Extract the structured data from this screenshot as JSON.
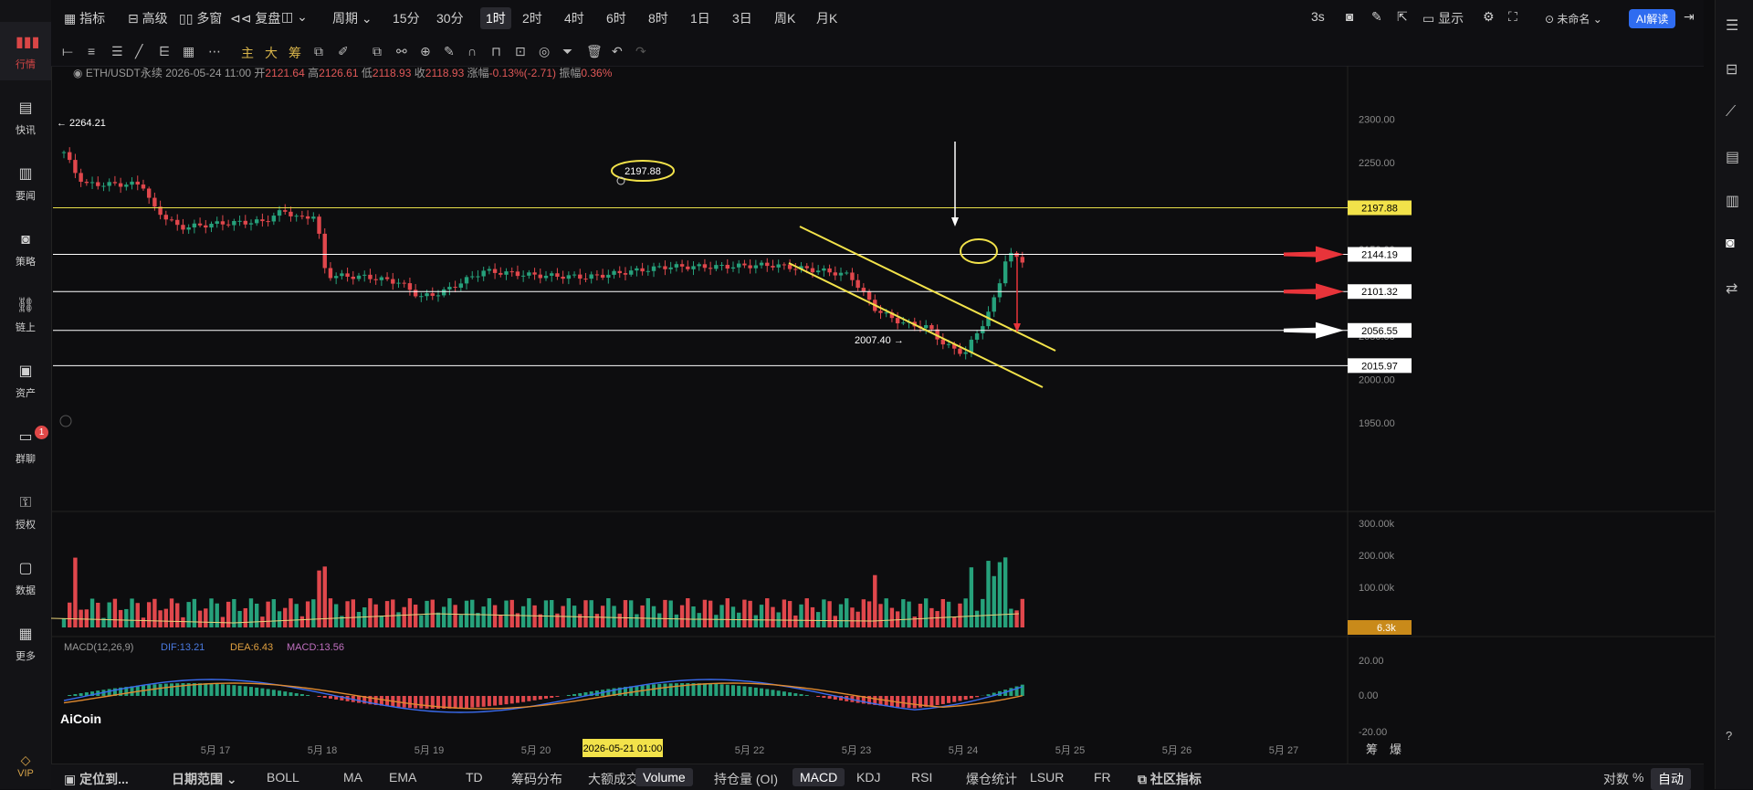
{
  "sidebar": {
    "items": [
      {
        "label": "行情",
        "icon": "bar-chart-icon",
        "active": true
      },
      {
        "label": "快讯",
        "icon": "news-flash-icon"
      },
      {
        "label": "要闻",
        "icon": "document-icon"
      },
      {
        "label": "策略",
        "icon": "robot-icon"
      },
      {
        "label": "链上",
        "icon": "chain-icon"
      },
      {
        "label": "资产",
        "icon": "wallet-icon"
      },
      {
        "label": "群聊",
        "icon": "chat-icon",
        "badge": "1"
      },
      {
        "label": "授权",
        "icon": "key-icon"
      },
      {
        "label": "数据",
        "icon": "monitor-icon"
      },
      {
        "label": "更多",
        "icon": "grid-icon"
      }
    ],
    "vip": "VIP"
  },
  "topbar": {
    "indicator": "指标",
    "advanced": "高级",
    "multi": "多窗",
    "replay": "复盘",
    "period": "周期",
    "timeframes": [
      "15分",
      "30分",
      "1时",
      "2时",
      "4时",
      "6时",
      "8时",
      "1日",
      "3日",
      "周K",
      "月K"
    ],
    "active_timeframe": "1时",
    "refresh": "3s",
    "display": "显示",
    "layout_name": "未命名",
    "ai": "AI解读"
  },
  "info": {
    "symbol": "ETH/USDT永续",
    "datetime": "2026-05-24 11:00",
    "open_label": "开",
    "open": "2121.64",
    "high_label": "高",
    "high": "2126.61",
    "low_label": "低",
    "low": "2118.93",
    "close_label": "收",
    "close": "2118.93",
    "change_label": "涨幅",
    "change": "-0.13%(-2.71)",
    "amp_label": "振幅",
    "amp": "0.36%"
  },
  "chart_data": {
    "type": "candlestick",
    "price_axis": {
      "ticks": [
        "2300.00",
        "2250.00",
        "2200.00",
        "2150.00",
        "2100.00",
        "2050.00",
        "2000.00",
        "1950.00"
      ],
      "range": [
        1930,
        2330
      ]
    },
    "volume_axis": {
      "ticks": [
        "300.00k",
        "200.00k",
        "100.00k"
      ],
      "current": "6.3k"
    },
    "macd_axis": {
      "ticks": [
        "20.00",
        "0.00",
        "-20.00"
      ]
    },
    "macd": {
      "label": "MACD(12,26,9)",
      "dif": "DIF:13.21",
      "dea": "DEA:6.43",
      "macd": "MACD:13.56"
    },
    "date_ticks": [
      "5月 17",
      "5月 18",
      "5月 19",
      "5月 20",
      "5月 21",
      "5月 22",
      "5月 23",
      "5月 24",
      "5月 25",
      "5月 26",
      "5月 27"
    ],
    "cursor_date": "2026-05-21 01:00",
    "levels": [
      {
        "label": "2197.88",
        "value": 2197.88,
        "color": "#e8e04a"
      },
      {
        "label": "2144.19",
        "value": 2144.19,
        "color": "#ffffff"
      },
      {
        "label": "2101.32",
        "value": 2101.32,
        "color": "#ffffff"
      },
      {
        "label": "2056.55",
        "value": 2056.55,
        "color": "#ffffff"
      },
      {
        "label": "2015.97",
        "value": 2015.97,
        "color": "#ffffff"
      }
    ],
    "high_mark": "2264.21",
    "low_mark": "2007.40",
    "circle_label": "2197.88",
    "colors": {
      "up": "#26a17b",
      "down": "#e0474c",
      "line": "#ffffff",
      "yellow": "#f2e24a"
    }
  },
  "bottombar": {
    "locate": "定位到...",
    "date_range": "日期范围",
    "indicators": [
      "BOLL",
      "MA",
      "EMA",
      "TD",
      "筹码分布",
      "大额成交"
    ],
    "panels": [
      "Volume",
      "持仓量 (OI)",
      "MACD",
      "KDJ",
      "RSI",
      "爆仓统计",
      "LSUR",
      "FR",
      "社区指标"
    ],
    "active_panels": [
      "Volume",
      "MACD"
    ],
    "log": "对数",
    "pct": "%",
    "auto": "自动"
  },
  "right_tabs": [
    "筹",
    "爆"
  ],
  "watermark": "AiCoin"
}
